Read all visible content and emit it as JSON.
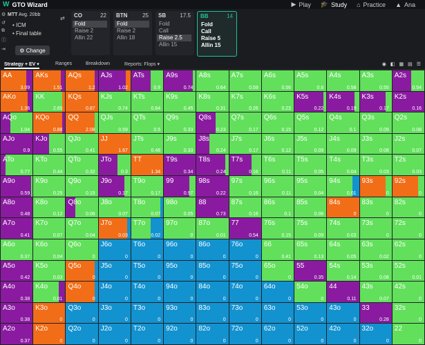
{
  "app": {
    "logo_letter": "W",
    "title": "GTO Wizard"
  },
  "nav": [
    {
      "icon": "play-icon",
      "glyph": "▶",
      "label": "Play",
      "active": false
    },
    {
      "icon": "study-icon",
      "glyph": "🎓",
      "label": "Study",
      "active": true
    },
    {
      "icon": "practice-icon",
      "glyph": "⌂",
      "label": "Practice",
      "active": false
    },
    {
      "icon": "analyze-icon",
      "glyph": "▲",
      "label": "Ana",
      "active": false
    }
  ],
  "game": {
    "format": "MTT",
    "avg": "Avg. 20bb",
    "option1": "ICM",
    "option2": "Final table",
    "change_label": "Change"
  },
  "positions": [
    {
      "name": "CO",
      "stack": "22",
      "actions": [
        "Fold",
        "Raise 2",
        "Allin 22"
      ],
      "selected": 0
    },
    {
      "name": "BTN",
      "stack": "25",
      "actions": [
        "Fold",
        "Raise 2",
        "Allin 18"
      ],
      "selected": 0
    },
    {
      "name": "SB",
      "stack": "17.5",
      "actions": [
        "Fold",
        "Call",
        "Raise 2.5",
        "Allin 15"
      ],
      "selected": 2
    },
    {
      "name": "BB",
      "stack": "14",
      "actions": [
        "Fold",
        "Call",
        "Raise 5",
        "Allin 15"
      ],
      "selected": -1,
      "active": true
    }
  ],
  "tabs": {
    "strategy": "Strategy + EV ▾",
    "ranges": "Ranges",
    "breakdown": "Breakdown",
    "reports": "Reports: Flops ▾"
  },
  "colors": {
    "fold": "#1392d0",
    "call": "#62e05c",
    "raise": "#f26d17",
    "allin": "#8a1ba0"
  },
  "rows": [
    [
      [
        "AA",
        "3.09",
        "r:80,a:20"
      ],
      [
        "AKs",
        "1.51",
        "r:85,a:15"
      ],
      [
        "AQs",
        "1.2",
        "r:90,a:10"
      ],
      [
        "AJs",
        "1.02",
        "a:85,r:15"
      ],
      [
        "ATs",
        "0.9",
        "a:60,c:40"
      ],
      [
        "A9s",
        "0.74",
        "a:90,c:10"
      ],
      [
        "A8s",
        "0.64",
        "c:100"
      ],
      [
        "A7s",
        "0.59",
        "c:100"
      ],
      [
        "A6s",
        "0.56",
        "c:100"
      ],
      [
        "A5s",
        "0.6",
        "c:100"
      ],
      [
        "A4s",
        "0.58",
        "c:100"
      ],
      [
        "A3s",
        "0.55",
        "c:100"
      ],
      [
        "A2s",
        "0.54",
        "a:60,c:40"
      ]
    ],
    [
      [
        "AKo",
        "1.36",
        "r:85,a:15"
      ],
      [
        "KK",
        "2.65",
        "c:90,r:10"
      ],
      [
        "KQs",
        "0.87",
        "r:100"
      ],
      [
        "KJs",
        "0.74",
        "c:100"
      ],
      [
        "KTs",
        "0.64",
        "c:100"
      ],
      [
        "K9s",
        "0.45",
        "c:100"
      ],
      [
        "K8s",
        "0.31",
        "c:100"
      ],
      [
        "K7s",
        "0.26",
        "c:100"
      ],
      [
        "K6s",
        "0.23",
        "c:100"
      ],
      [
        "K5s",
        "0.22",
        "a:90,c:10"
      ],
      [
        "K4s",
        "0.19",
        "a:85,c:15"
      ],
      [
        "K3s",
        "0.17",
        "a:80,c:20"
      ],
      [
        "K2s",
        "0.16",
        "a:100"
      ]
    ],
    [
      [
        "AQo",
        "1.04",
        "a:30,c:70"
      ],
      [
        "KQo",
        "0.88",
        "r:90,a:10"
      ],
      [
        "QQ",
        "2.08",
        "r:90,c:10"
      ],
      [
        "QJs",
        "0.59",
        "c:100"
      ],
      [
        "QTs",
        "0.5",
        "c:100"
      ],
      [
        "Q9s",
        "0.33",
        "c:100"
      ],
      [
        "Q8s",
        "0.23",
        "a:60,c:40"
      ],
      [
        "Q7s",
        "0.17",
        "c:100"
      ],
      [
        "Q6s",
        "0.15",
        "c:100"
      ],
      [
        "Q5s",
        "0.12",
        "c:100"
      ],
      [
        "Q4s",
        "0.1",
        "c:100"
      ],
      [
        "Q3s",
        "0.09",
        "c:100"
      ],
      [
        "Q2s",
        "0.08",
        "c:100"
      ]
    ],
    [
      [
        "AJo",
        "0.9",
        "a:100"
      ],
      [
        "KJo",
        "0.55",
        "a:50,c:50"
      ],
      [
        "QJo",
        "0.41",
        "c:100"
      ],
      [
        "JJ",
        "1.67",
        "r:100"
      ],
      [
        "JTs",
        "0.48",
        "c:100"
      ],
      [
        "J9s",
        "0.33",
        "c:100"
      ],
      [
        "J8s",
        "0.24",
        "a:40,c:60"
      ],
      [
        "J7s",
        "0.17",
        "c:100"
      ],
      [
        "J6s",
        "0.12",
        "c:100"
      ],
      [
        "J5s",
        "0.09",
        "c:100"
      ],
      [
        "J4s",
        "0.09",
        "c:100"
      ],
      [
        "J3s",
        "0.08",
        "c:100"
      ],
      [
        "J2s",
        "0.07",
        "c:100"
      ]
    ],
    [
      [
        "ATo",
        "0.77",
        "a:15,c:85"
      ],
      [
        "KTo",
        "0.44",
        "c:100"
      ],
      [
        "QTo",
        "0.32",
        "c:100"
      ],
      [
        "JTo",
        "0.3",
        "a:60,c:40"
      ],
      [
        "TT",
        "1.34",
        "r:100"
      ],
      [
        "T9s",
        "0.34",
        "a:100"
      ],
      [
        "T8s",
        "0.24",
        "a:90,c:10"
      ],
      [
        "T7s",
        "0.16",
        "a:70,c:30"
      ],
      [
        "T6s",
        "0.11",
        "c:100"
      ],
      [
        "T5s",
        "0.05",
        "c:100"
      ],
      [
        "T4s",
        "0.04",
        "c:100"
      ],
      [
        "T3s",
        "0.03",
        "c:100"
      ],
      [
        "T2s",
        "0.03",
        "c:100"
      ]
    ],
    [
      [
        "A9o",
        "0.59",
        "a:95,c:5"
      ],
      [
        "K9o",
        "0.25",
        "c:100"
      ],
      [
        "Q9o",
        "0.15",
        "c:100"
      ],
      [
        "J9o",
        "0.17",
        "a:80,c:20"
      ],
      [
        "T9o",
        "0.17",
        "c:100"
      ],
      [
        "99",
        "0.97",
        "a:80,c:20"
      ],
      [
        "98s",
        "0.22",
        "a:100"
      ],
      [
        "97s",
        "0.16",
        "c:100"
      ],
      [
        "96s",
        "0.11",
        "c:100"
      ],
      [
        "95s",
        "0.04",
        "c:100"
      ],
      [
        "94s",
        "0.01",
        "c:80,f:20"
      ],
      [
        "93s",
        "0",
        "r:80,c:20"
      ],
      [
        "92s",
        "0",
        "r:80,c:20"
      ]
    ],
    [
      [
        "A8o",
        "0.48",
        "a:100"
      ],
      [
        "K8o",
        "0.12",
        "c:100"
      ],
      [
        "Q8o",
        "0.06",
        "a:30,c:70"
      ],
      [
        "J8o",
        "0.07",
        "c:100"
      ],
      [
        "T8o",
        "0.07",
        "c:90,f:10"
      ],
      [
        "98o",
        "0.05",
        "c:100"
      ],
      [
        "88",
        "0.73",
        "a:100"
      ],
      [
        "87s",
        "0.16",
        "c:100"
      ],
      [
        "86s",
        "0.1",
        "c:100"
      ],
      [
        "85s",
        "0.06",
        "c:100"
      ],
      [
        "84s",
        "0",
        "r:100"
      ],
      [
        "83s",
        "0",
        "c:100"
      ],
      [
        "82s",
        "0",
        "c:100"
      ]
    ],
    [
      [
        "A7o",
        "0.41",
        "a:100"
      ],
      [
        "K7o",
        "0.07",
        "c:100"
      ],
      [
        "Q7o",
        "0.04",
        "c:100"
      ],
      [
        "J7o",
        "0.03",
        "r:90,f:10"
      ],
      [
        "T7o",
        "0.02",
        "c:60,f:40"
      ],
      [
        "97o",
        "0",
        "c:100"
      ],
      [
        "87o",
        "0.01",
        "c:100"
      ],
      [
        "77",
        "0.54",
        "a:100"
      ],
      [
        "76s",
        "0.15",
        "c:100"
      ],
      [
        "75s",
        "0.09",
        "c:100"
      ],
      [
        "74s",
        "0.03",
        "c:100"
      ],
      [
        "73s",
        "0",
        "c:100"
      ],
      [
        "72s",
        "0",
        "c:100"
      ]
    ],
    [
      [
        "A6o",
        "0.37",
        "c:100"
      ],
      [
        "K6o",
        "0.04",
        "c:100"
      ],
      [
        "Q6o",
        "0",
        "c:100"
      ],
      [
        "J6o",
        "0",
        "f:100"
      ],
      [
        "T6o",
        "0",
        "f:100"
      ],
      [
        "96o",
        "0",
        "f:100"
      ],
      [
        "86o",
        "0",
        "f:100"
      ],
      [
        "76o",
        "0",
        "f:100"
      ],
      [
        "66",
        "0.41",
        "c:100"
      ],
      [
        "65s",
        "0.13",
        "c:100"
      ],
      [
        "64s",
        "0.05",
        "c:100"
      ],
      [
        "63s",
        "0.02",
        "c:100"
      ],
      [
        "62s",
        "0",
        "c:100"
      ]
    ],
    [
      [
        "A5o",
        "0.42",
        "a:100"
      ],
      [
        "K5o",
        "0.03",
        "c:100"
      ],
      [
        "Q5o",
        "0",
        "r:90,f:10"
      ],
      [
        "J5o",
        "0",
        "f:100"
      ],
      [
        "T5o",
        "0",
        "f:100"
      ],
      [
        "95o",
        "0",
        "f:100"
      ],
      [
        "85o",
        "0",
        "f:100"
      ],
      [
        "75o",
        "0",
        "f:100"
      ],
      [
        "65o",
        "0",
        "c:100"
      ],
      [
        "55",
        "0.35",
        "a:100"
      ],
      [
        "54s",
        "0.14",
        "c:100"
      ],
      [
        "53s",
        "0.08",
        "c:100"
      ],
      [
        "52s",
        "0.01",
        "c:100"
      ]
    ],
    [
      [
        "A4o",
        "0.38",
        "a:100"
      ],
      [
        "K4o",
        "0.01",
        "c:80,a:20"
      ],
      [
        "Q4o",
        "0",
        "r:90,f:10"
      ],
      [
        "J4o",
        "0",
        "f:100"
      ],
      [
        "T4o",
        "0",
        "f:100"
      ],
      [
        "94o",
        "0",
        "f:100"
      ],
      [
        "84o",
        "0",
        "f:100"
      ],
      [
        "74o",
        "0",
        "f:100"
      ],
      [
        "64o",
        "0",
        "f:100"
      ],
      [
        "54o",
        "0",
        "c:100"
      ],
      [
        "44",
        "0.11",
        "a:100"
      ],
      [
        "43s",
        "0.07",
        "c:100"
      ],
      [
        "42s",
        "0",
        "c:100"
      ]
    ],
    [
      [
        "A3o",
        "0.38",
        "a:100"
      ],
      [
        "K3o",
        "0",
        "r:100"
      ],
      [
        "Q3o",
        "0",
        "f:100"
      ],
      [
        "J3o",
        "0",
        "f:100"
      ],
      [
        "T3o",
        "0",
        "f:100"
      ],
      [
        "93o",
        "0",
        "f:100"
      ],
      [
        "83o",
        "0",
        "f:100"
      ],
      [
        "73o",
        "0",
        "f:100"
      ],
      [
        "63o",
        "0",
        "f:100"
      ],
      [
        "53o",
        "0",
        "f:100"
      ],
      [
        "43o",
        "0",
        "f:100"
      ],
      [
        "33",
        "0.28",
        "a:100"
      ],
      [
        "32s",
        "0",
        "c:100"
      ]
    ],
    [
      [
        "A2o",
        "0.37",
        "a:100"
      ],
      [
        "K2o",
        "0",
        "r:100"
      ],
      [
        "Q2o",
        "0",
        "f:100"
      ],
      [
        "J2o",
        "0",
        "f:100"
      ],
      [
        "T2o",
        "0",
        "f:100"
      ],
      [
        "92o",
        "0",
        "f:100"
      ],
      [
        "82o",
        "0",
        "f:100"
      ],
      [
        "72o",
        "0",
        "f:100"
      ],
      [
        "62o",
        "0",
        "f:100"
      ],
      [
        "52o",
        "0",
        "f:100"
      ],
      [
        "42o",
        "0",
        "f:100"
      ],
      [
        "32o",
        "0",
        "f:100"
      ],
      [
        "22",
        "0",
        "c:100"
      ]
    ]
  ]
}
